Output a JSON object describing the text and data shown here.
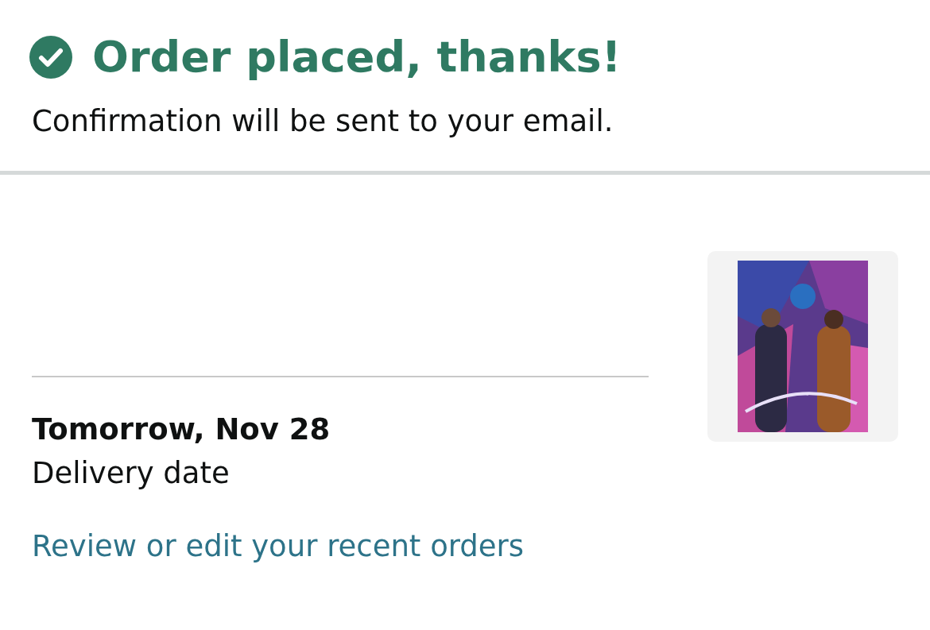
{
  "confirmation": {
    "title": "Order placed, thanks!",
    "message": "Confirmation will be sent to your email."
  },
  "shipment": {
    "delivery_date": "Tomorrow, Nov 28",
    "delivery_label": "Delivery date"
  },
  "link": "Review or edit your recent orders"
}
